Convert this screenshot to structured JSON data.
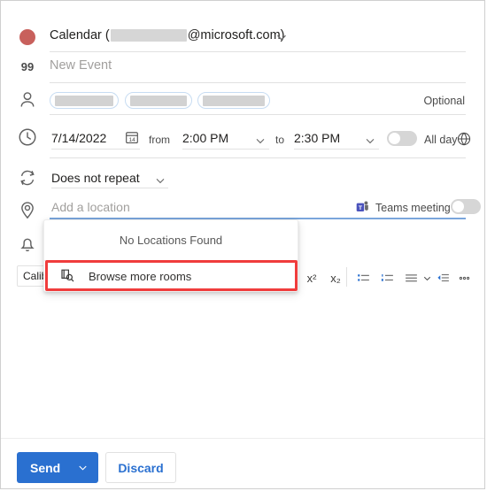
{
  "colors": {
    "calendar_dot": "#c8605c",
    "accent_blue": "#2a70d0",
    "highlight_red": "#f03c3c",
    "focus_underline": "#7aa6dc",
    "teams_purple": "#4b53bc"
  },
  "header": {
    "calendar_prefix": "Calendar (",
    "calendar_suffix": "@microsoft.com)",
    "dot_icon": "calendar-color-dot",
    "chevron_icon": "chevron-down-icon"
  },
  "title_row": {
    "icon": "title-quote-icon",
    "icon_glyph": "99",
    "placeholder": "New Event",
    "value": ""
  },
  "attendees": {
    "icon": "person-icon",
    "chips": [
      {
        "label": "",
        "redacted": true
      },
      {
        "label": "",
        "redacted": true
      },
      {
        "label": "",
        "redacted": true
      }
    ],
    "optional_label": "Optional"
  },
  "datetime": {
    "icon": "clock-icon",
    "date_value": "7/14/2022",
    "date_picker_icon": "calendar-picker-icon",
    "date_picker_day": "14",
    "from_label": "from",
    "start_time": "2:00 PM",
    "start_chevron_icon": "chevron-down-icon",
    "to_label": "to",
    "end_time": "2:30 PM",
    "end_chevron_icon": "chevron-down-icon",
    "all_day_label": "All day",
    "all_day_toggle": "off",
    "timezone_icon": "globe-icon"
  },
  "repeat": {
    "icon": "repeat-icon",
    "value": "Does not repeat",
    "chevron_icon": "chevron-down-icon"
  },
  "location": {
    "icon": "location-pin-icon",
    "placeholder": "Add a location",
    "value": "",
    "teams_icon": "teams-icon",
    "teams_label": "Teams meeting",
    "teams_toggle": "off"
  },
  "location_dropdown": {
    "empty_message": "No Locations Found",
    "browse_item": {
      "icon": "browse-rooms-icon",
      "label": "Browse more rooms",
      "highlighted": true
    }
  },
  "reminder": {
    "icon": "bell-icon"
  },
  "format_toolbar": {
    "font_name": "Calibri",
    "buttons": [
      {
        "name": "superscript",
        "glyph": "x²"
      },
      {
        "name": "subscript",
        "glyph": "x₂"
      },
      {
        "name": "bulleted-list",
        "glyph": "bulleted-list-icon"
      },
      {
        "name": "numbered-list",
        "glyph": "numbered-list-icon"
      },
      {
        "name": "align",
        "glyph": "align-icon"
      },
      {
        "name": "align-chevron",
        "glyph": "chevron-down-icon"
      },
      {
        "name": "indent",
        "glyph": "indent-icon"
      },
      {
        "name": "more-options",
        "glyph": "ellipsis-icon"
      }
    ]
  },
  "footer": {
    "send_label": "Send",
    "send_chevron_icon": "chevron-down-icon",
    "discard_label": "Discard"
  }
}
